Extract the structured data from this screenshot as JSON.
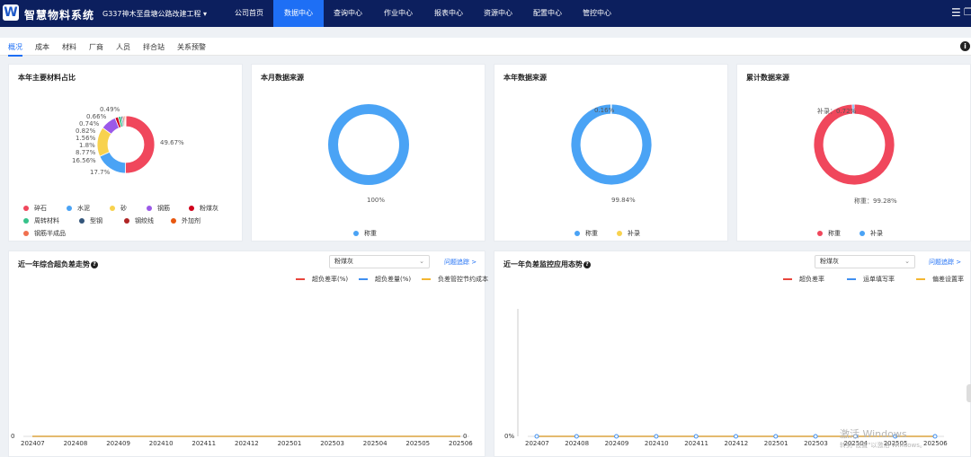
{
  "header": {
    "logo_letter": "W",
    "system_name": "智慧物料系统",
    "project": "G337神木至盘塘公路改建工程",
    "project_caret": "▾",
    "nav": [
      "公司首页",
      "数据中心",
      "查询中心",
      "作业中心",
      "报表中心",
      "资源中心",
      "配置中心",
      "管控中心"
    ],
    "active_nav": "数据中心",
    "menu_glyph": "☰",
    "window_glyph": "❐"
  },
  "tabs": [
    "概况",
    "成本",
    "材料",
    "厂商",
    "人员",
    "拌合站",
    "关系预警"
  ],
  "active_tab": "概况",
  "info_glyph": "i",
  "colors": {
    "red": "#f0475c",
    "blue": "#4aa3f5",
    "yellow": "#f8d24e",
    "purple": "#9b59e8",
    "darkred": "#d0021b",
    "green": "#36c28a",
    "navy": "#33557a",
    "maroon": "#b02525",
    "orange": "#e8570f",
    "salmon": "#f0704f",
    "line_red": "#e8453c",
    "line_blue": "#3f8ff0",
    "line_gold": "#f4b630"
  },
  "panels": {
    "materials": {
      "title": "本年主要材料占比",
      "labels": [
        "49.67%",
        "17.7%",
        "16.56%",
        "8.77%",
        "1.8%",
        "1.56%",
        "0.82%",
        "0.74%",
        "0.66%",
        "0.49%"
      ],
      "legend": [
        "碎石",
        "水泥",
        "砂",
        "钢筋",
        "粉煤灰",
        "周转材料",
        "型钢",
        "钢绞线",
        "外加剂",
        "钢筋半成品"
      ]
    },
    "month_source": {
      "title": "本月数据来源",
      "labels": [
        "100%"
      ],
      "legend": [
        "称重"
      ]
    },
    "year_source": {
      "title": "本年数据来源",
      "labels": [
        "0.16%",
        "99.84%"
      ],
      "legend": [
        "称重",
        "补录"
      ]
    },
    "total_source": {
      "title": "累计数据来源",
      "labels": [
        "补录：0.72%",
        "称重：99.28%"
      ],
      "legend": [
        "称重",
        "补录"
      ]
    },
    "trend_left": {
      "title": "近一年综合超负差走势",
      "help": "?",
      "select_value": "粉煤灰",
      "select_caret": "⌄",
      "link": "问题追踪 >",
      "legend": [
        "超负差率(%)",
        "超负差量(%)",
        "负差管控节约成本"
      ],
      "left_zero": "0",
      "right_zero": "0"
    },
    "trend_right": {
      "title": "近一年负差监控应用态势",
      "help": "?",
      "select_value": "粉煤灰",
      "select_caret": "⌄",
      "link": "问题追踪 >",
      "legend": [
        "超负差率",
        "运单填写率",
        "偏差设置率"
      ],
      "y_zero": "0%"
    }
  },
  "chart_data": [
    {
      "type": "pie",
      "title": "本年主要材料占比",
      "style": "donut",
      "categories": [
        "碎石",
        "水泥",
        "砂",
        "钢筋",
        "粉煤灰",
        "周转材料",
        "型钢",
        "钢绞线",
        "外加剂",
        "钢筋半成品"
      ],
      "values": [
        49.67,
        17.7,
        16.56,
        8.77,
        1.8,
        1.56,
        0.82,
        0.74,
        0.66,
        0.49
      ],
      "unit": "%"
    },
    {
      "type": "pie",
      "title": "本月数据来源",
      "style": "donut",
      "categories": [
        "称重"
      ],
      "values": [
        100
      ],
      "unit": "%"
    },
    {
      "type": "pie",
      "title": "本年数据来源",
      "style": "donut",
      "categories": [
        "称重",
        "补录"
      ],
      "values": [
        99.84,
        0.16
      ],
      "unit": "%"
    },
    {
      "type": "pie",
      "title": "累计数据来源",
      "style": "donut",
      "categories": [
        "称重",
        "补录"
      ],
      "values": [
        99.28,
        0.72
      ],
      "unit": "%"
    },
    {
      "type": "line",
      "title": "近一年综合超负差走势",
      "categories": [
        "202407",
        "202408",
        "202409",
        "202410",
        "202411",
        "202412",
        "202501",
        "202503",
        "202504",
        "202505",
        "202506"
      ],
      "series": [
        {
          "name": "超负差率(%)",
          "values": [
            0,
            0,
            0,
            0,
            0,
            0,
            0,
            0,
            0,
            0,
            0
          ]
        },
        {
          "name": "超负差量(%)",
          "values": [
            0,
            0,
            0,
            0,
            0,
            0,
            0,
            0,
            0,
            0,
            0
          ]
        },
        {
          "name": "负差管控节约成本",
          "values": [
            0,
            0,
            0,
            0,
            0,
            0,
            0,
            0,
            0,
            0,
            0
          ]
        }
      ]
    },
    {
      "type": "line",
      "title": "近一年负差监控应用态势",
      "categories": [
        "202407",
        "202408",
        "202409",
        "202410",
        "202411",
        "202412",
        "202501",
        "202503",
        "202504",
        "202505",
        "202506"
      ],
      "series": [
        {
          "name": "超负差率",
          "values": [
            0,
            0,
            0,
            0,
            0,
            0,
            0,
            0,
            0,
            0,
            0
          ]
        },
        {
          "name": "运单填写率",
          "values": [
            0,
            0,
            0,
            0,
            0,
            0,
            0,
            0,
            0,
            0,
            0
          ]
        },
        {
          "name": "偏差设置率",
          "values": [
            0,
            0,
            0,
            0,
            0,
            0,
            0,
            0,
            0,
            0,
            0
          ]
        }
      ],
      "y_unit": "%"
    }
  ],
  "watermark": {
    "line1": "激活 Windows",
    "line2": "转到\"设置\"以激活 Windows。"
  }
}
